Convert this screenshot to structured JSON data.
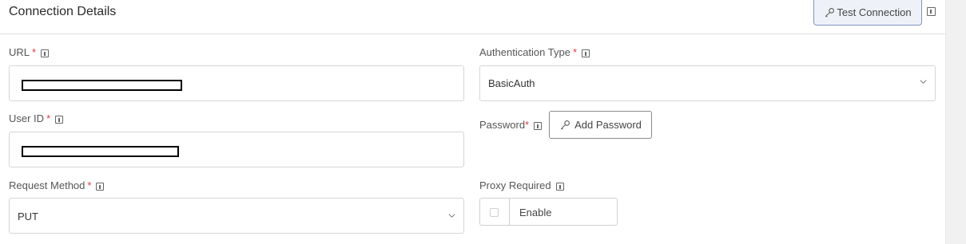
{
  "header": {
    "title": "Connection Details",
    "test_connection_label": "Test Connection"
  },
  "form": {
    "url": {
      "label": "URL",
      "required_mark": "*"
    },
    "auth_type": {
      "label": "Authentication Type",
      "required_mark": "*",
      "value": "BasicAuth"
    },
    "user_id": {
      "label": "User ID",
      "required_mark": "*"
    },
    "password": {
      "label": "Password",
      "required_mark": "*",
      "button_label": "Add Password"
    },
    "request_method": {
      "label": "Request Method",
      "required_mark": "*",
      "value": "PUT"
    },
    "proxy": {
      "label": "Proxy Required",
      "checkbox_label": "Enable",
      "checked": false
    }
  },
  "icons": {
    "test_connection": "key-icon",
    "add_password": "key-icon",
    "info": "info-icon",
    "dropdown": "chevron-down-icon"
  },
  "colors": {
    "required": "#e0393e",
    "test_button_bg": "#eef2f8",
    "test_button_border": "#7d93bf"
  }
}
